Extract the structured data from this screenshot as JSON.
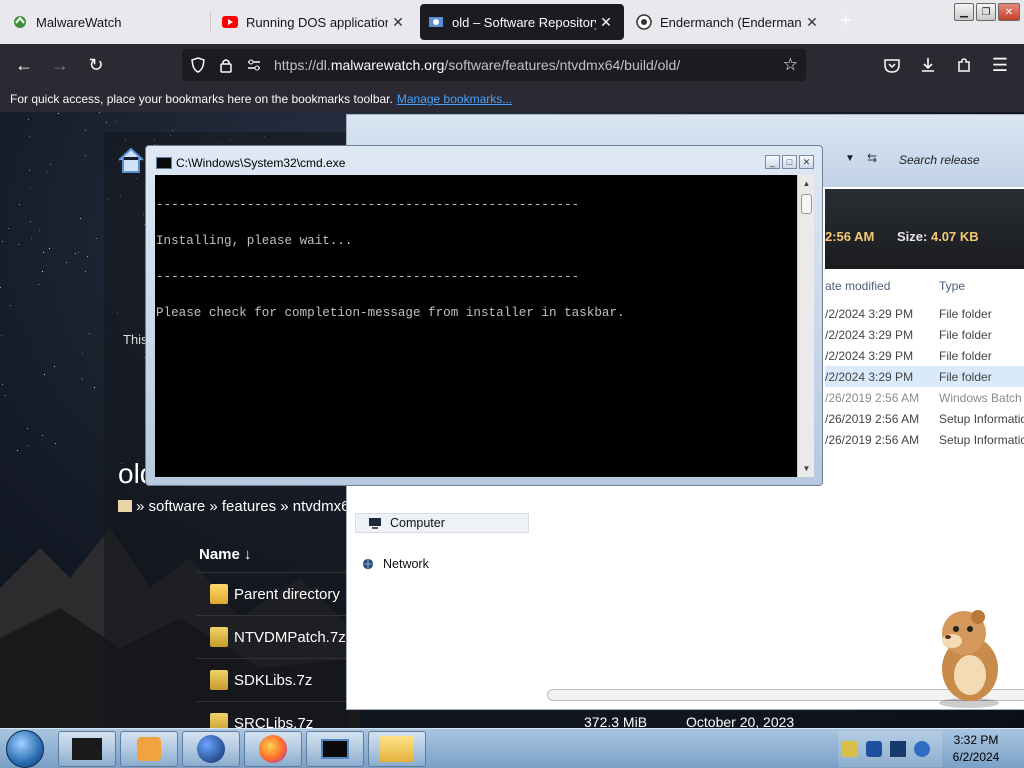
{
  "browser": {
    "tabs": [
      {
        "title": "MalwareWatch",
        "favicon": "malwarewatch-icon",
        "active": false
      },
      {
        "title": "Running DOS applications o",
        "favicon": "youtube-icon",
        "active": false
      },
      {
        "title": "old – Software Repository",
        "favicon": "repository-icon",
        "active": true
      },
      {
        "title": "Endermanch (Endermanch)",
        "favicon": "github-icon",
        "active": false
      }
    ],
    "new_tab_label": "+",
    "url_prefix": "https://dl.",
    "url_domain": "malwarewatch.org",
    "url_path": "/software/features/ntvdmx64/build/old/",
    "bookmarks_text": "For quick access, place your bookmarks here on the bookmarks toolbar.",
    "bookmarks_link": "Manage bookmarks..."
  },
  "page": {
    "title": "old",
    "side_text": "This",
    "breadcrumb": "» software » features » ntvdmx6",
    "name_header": "Name ↓",
    "files": [
      {
        "name": "Parent directory",
        "kind": "folder"
      },
      {
        "name": "NTVDMPatch.7z",
        "kind": "archive"
      },
      {
        "name": "SDKLibs.7z",
        "kind": "archive"
      },
      {
        "name": "SRCLibs.7z",
        "kind": "archive"
      }
    ],
    "last_size": "372.3 MiB",
    "last_date": "October 20, 2023"
  },
  "explorer": {
    "search_placeholder": "Search release",
    "modified_partial": "2:56 AM",
    "size_label": "Size:",
    "size_value": "4.07 KB",
    "col_date": "ate modified",
    "col_type": "Type",
    "rows": [
      {
        "date": "/2/2024 3:29 PM",
        "type": "File folder"
      },
      {
        "date": "/2/2024 3:29 PM",
        "type": "File folder"
      },
      {
        "date": "/2/2024 3:29 PM",
        "type": "File folder"
      },
      {
        "date": "/2/2024 3:29 PM",
        "type": "File folder"
      },
      {
        "date": "/26/2019 2:56 AM",
        "type": "Windows Batch F"
      },
      {
        "date": "/26/2019 2:56 AM",
        "type": "Setup Informatio"
      },
      {
        "date": "/26/2019 2:56 AM",
        "type": "Setup Informatio"
      }
    ],
    "nav_computer": "Computer",
    "nav_network": "Network"
  },
  "cmd": {
    "title": "C:\\Windows\\System32\\cmd.exe",
    "lines": [
      "--------------------------------------------------------",
      "Installing, please wait...",
      "--------------------------------------------------------",
      "Please check for completion-message from installer in taskbar."
    ]
  },
  "taskbar": {
    "time": "3:32 PM",
    "date": "6/2/2024"
  },
  "colors": {
    "accent_link": "#45a1ff",
    "browser_dark": "#1c1b22",
    "explorer_highlight": "#f6c871"
  }
}
